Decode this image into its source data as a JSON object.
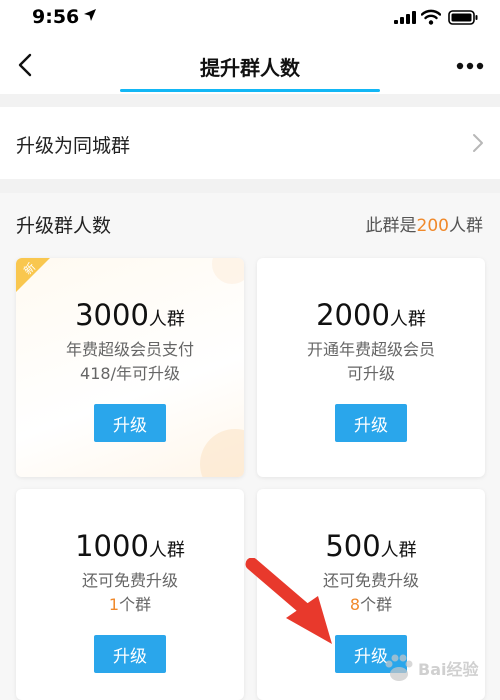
{
  "status_bar": {
    "time": "9:56",
    "icons": [
      "location-arrow-icon",
      "signal-icon",
      "wifi-icon",
      "battery-icon"
    ]
  },
  "nav": {
    "title": "提升群人数",
    "back_icon": "chevron-left-icon",
    "more_icon": "more-dots-icon",
    "accent_color": "#12b7f5"
  },
  "city_group_row": {
    "label": "升级为同城群",
    "chevron_icon": "chevron-right-icon"
  },
  "upgrade_section": {
    "label": "升级群人数",
    "current_prefix": "此群是",
    "current_value": "200",
    "current_suffix": "人群",
    "highlight_color": "#f0892b",
    "button_color": "#2aa6eb",
    "cards": [
      {
        "badge": "新",
        "capacity": "3000",
        "unit": "人群",
        "line1": "年费超级会员支付",
        "line2_value": "",
        "line2_text": "418/年可升级",
        "button": "升级"
      },
      {
        "capacity": "2000",
        "unit": "人群",
        "line1": "开通年费超级会员",
        "line2_value": "",
        "line2_text": "可升级",
        "button": "升级"
      },
      {
        "capacity": "1000",
        "unit": "人群",
        "line1": "还可免费升级",
        "line2_value": "1",
        "line2_text": "个群",
        "button": "升级"
      },
      {
        "capacity": "500",
        "unit": "人群",
        "line1": "还可免费升级",
        "line2_value": "8",
        "line2_text": "个群",
        "button": "升级"
      }
    ]
  },
  "overlay": {
    "arrow_icon": "red-arrow-annotation-icon",
    "watermark_logo": "baidu-jingyan-watermark",
    "watermark_text": "Bai经验"
  }
}
